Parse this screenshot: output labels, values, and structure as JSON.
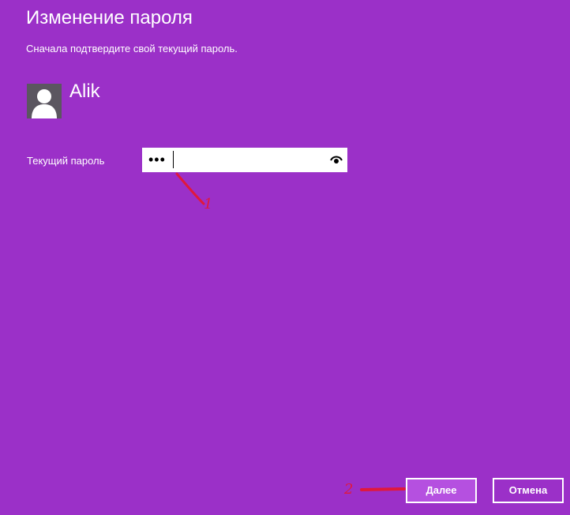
{
  "dialog": {
    "title": "Изменение пароля",
    "subtitle": "Сначала подтвердите свой текущий пароль."
  },
  "user": {
    "name": "Alik",
    "avatar_icon": "user-silhouette-icon"
  },
  "password_field": {
    "label": "Текущий пароль",
    "value": "•••",
    "reveal_icon": "eye-icon"
  },
  "annotations": {
    "marker_1": "1",
    "marker_2": "2",
    "color": "#e0183c"
  },
  "buttons": {
    "next_label": "Далее",
    "cancel_label": "Отмена"
  },
  "colors": {
    "background": "#9b30c8",
    "primary_button": "#b550e0",
    "avatar_background": "#5b5660"
  }
}
